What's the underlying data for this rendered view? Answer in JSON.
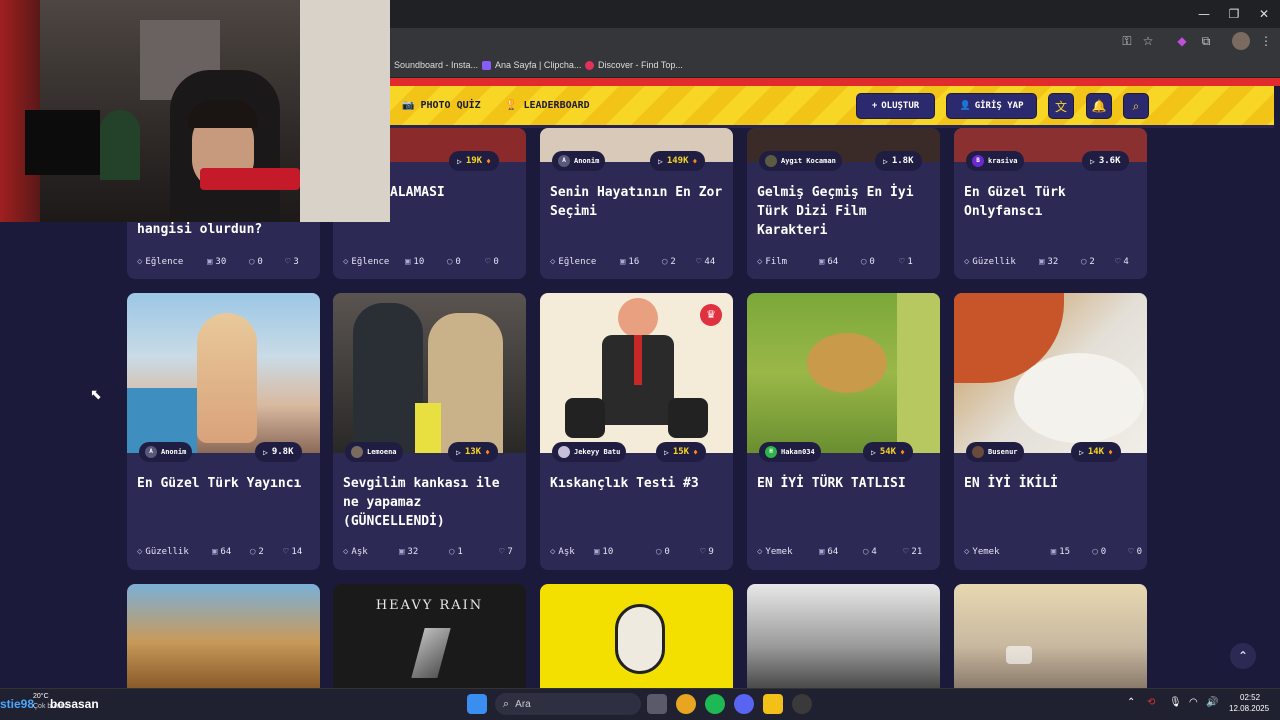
{
  "browser": {
    "bookmarks": [
      "Soundboard - Insta...",
      "Ana Sayfa | Clipcha...",
      "Discover - Find Top..."
    ]
  },
  "header": {
    "nav": [
      "PHOTO QUİZ",
      "LEADERBOARD"
    ],
    "create_label": "OLUŞTUR",
    "login_label": "GİRİŞ YAP"
  },
  "cards": [
    {
      "author": "",
      "plays": "19K",
      "title": "AG SIRALAMASI",
      "category": "Eğlence",
      "questions": "10",
      "comments": "0",
      "likes": "0"
    },
    {
      "author": "Anonim",
      "plays": "149K",
      "title": "Senin Hayatının En Zor Seçimi",
      "category": "Eğlence",
      "questions": "16",
      "comments": "2",
      "likes": "44"
    },
    {
      "author": "Aygıt Kocaman",
      "plays": "1.8K",
      "title": "Gelmiş Geçmiş En İyi Türk Dizi Film Karakteri",
      "category": "Film",
      "questions": "64",
      "comments": "0",
      "likes": "1"
    },
    {
      "author": "krasiva",
      "plays": "3.6K",
      "title": "En Güzel Türk Onlyfanscı",
      "category": "Güzellik",
      "questions": "32",
      "comments": "2",
      "likes": "4"
    },
    {
      "author": "",
      "plays": "",
      "title": "hangisi olurdun?",
      "category": "Eğlence",
      "questions": "30",
      "comments": "0",
      "likes": "3"
    },
    {
      "author": "Anonim",
      "plays": "9.8K",
      "title": "En Güzel Türk Yayıncı",
      "category": "Güzellik",
      "questions": "64",
      "comments": "2",
      "likes": "14"
    },
    {
      "author": "Lemoena",
      "plays": "13K",
      "title": "Sevgilim kankası ile ne yapamaz (GÜNCELLENDİ)",
      "category": "Aşk",
      "questions": "32",
      "comments": "1",
      "likes": "7"
    },
    {
      "author": "Jekeyy Batu",
      "plays": "15K",
      "title": "Kıskançlık Testi #3",
      "category": "Aşk",
      "questions": "10",
      "comments": "0",
      "likes": "9"
    },
    {
      "author": "Hakan034",
      "plays": "54K",
      "title": "EN İYİ TÜRK TATLISI",
      "category": "Yemek",
      "questions": "64",
      "comments": "4",
      "likes": "21"
    },
    {
      "author": "Busenur",
      "plays": "14K",
      "title": "EN İYİ İKİLİ",
      "category": "Yemek",
      "questions": "15",
      "comments": "0",
      "likes": "0"
    }
  ],
  "bottom_row": {
    "heavy_rain_text": "HEAVY RAIN"
  },
  "taskbar": {
    "search_placeholder": "Ara",
    "weather_temp": "20°C",
    "weather_desc": "Çok bulutlu",
    "overlay_name": "bosasan",
    "overlay_prefix": "stie98",
    "time": "02:52",
    "date": "12.08.2025"
  }
}
